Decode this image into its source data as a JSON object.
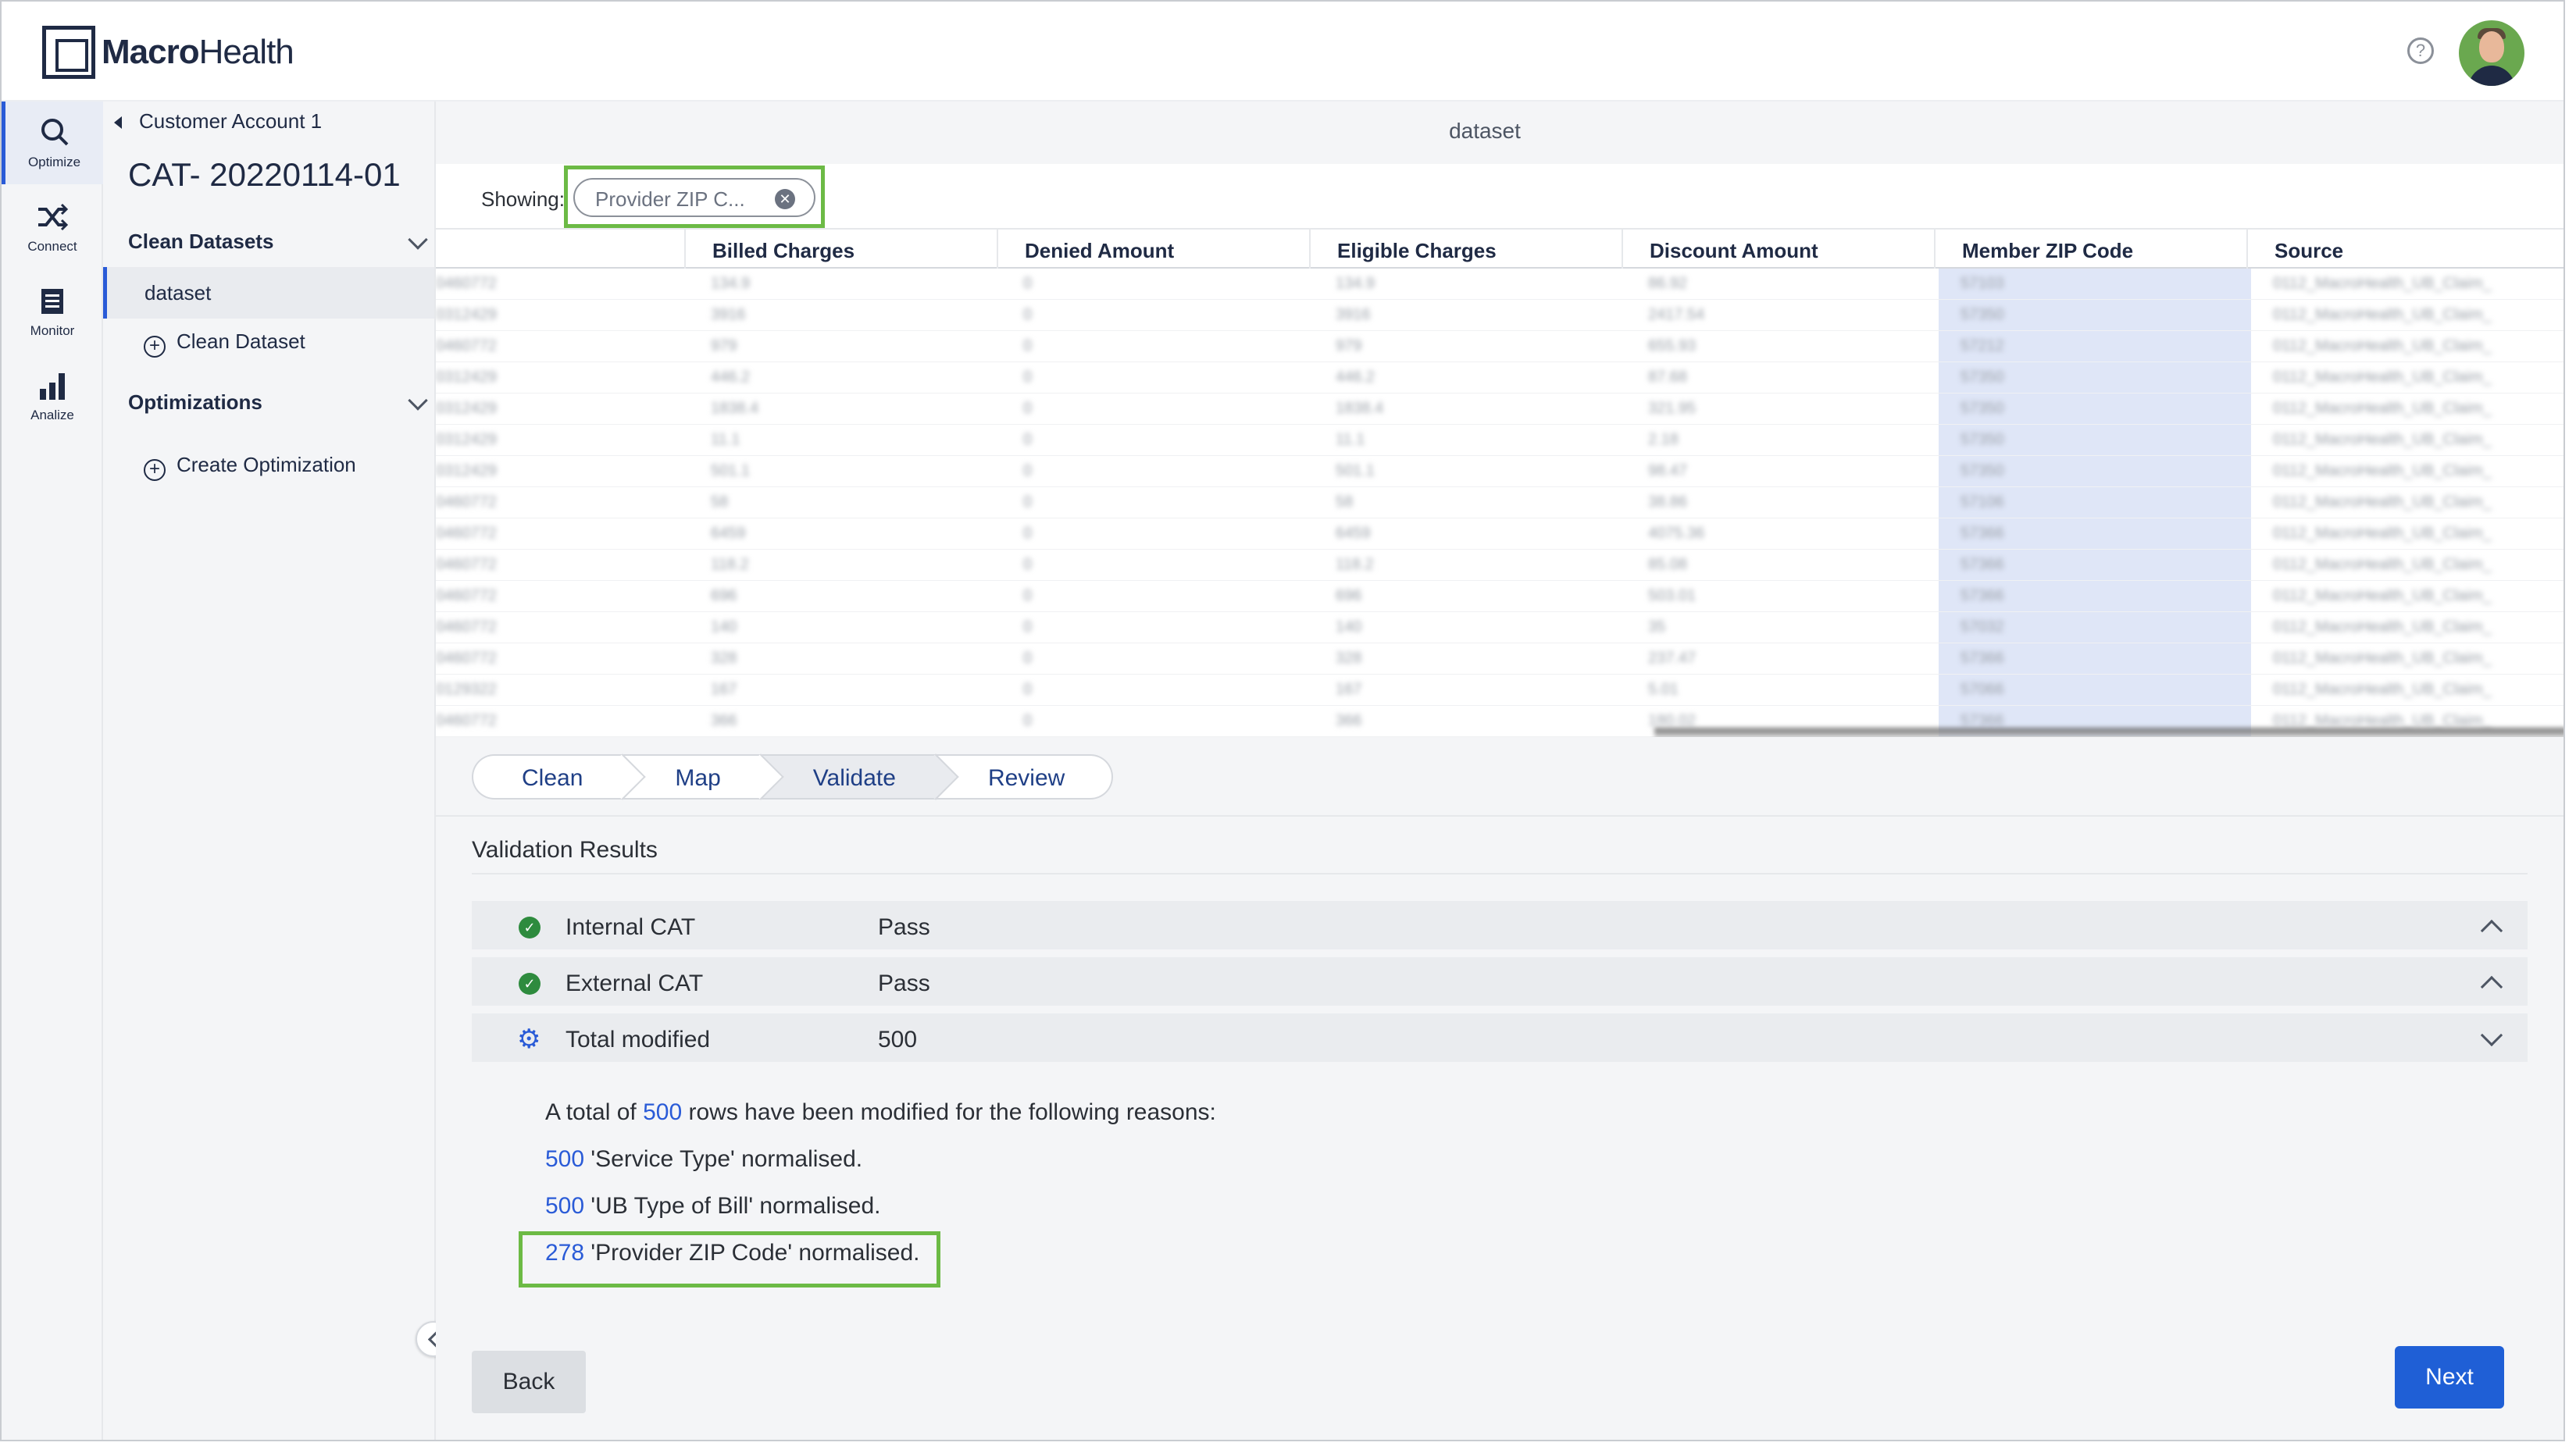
{
  "brand": {
    "name_bold": "Macro",
    "name_light": "Health"
  },
  "header": {
    "help_glyph": "?"
  },
  "rail": [
    {
      "label": "Optimize",
      "icon": "search-icon"
    },
    {
      "label": "Connect",
      "icon": "shuffle-icon"
    },
    {
      "label": "Monitor",
      "icon": "document-icon"
    },
    {
      "label": "Analize",
      "icon": "bar-chart-icon"
    }
  ],
  "sidebar": {
    "breadcrumb": "Customer Account 1",
    "project_title": "CAT- 20220114-01",
    "section_clean": "Clean Datasets",
    "dataset_item": "dataset",
    "add_clean": "Clean Dataset",
    "section_opt": "Optimizations",
    "add_opt": "Create Optimization"
  },
  "main": {
    "title": "dataset",
    "showing_label": "Showing:",
    "filter_chip": "Provider ZIP C..."
  },
  "table": {
    "columns": [
      "Billed Charges",
      "Denied Amount",
      "Eligible Charges",
      "Discount Amount",
      "Member ZIP Code",
      "Source"
    ],
    "rows": [
      [
        "0460772",
        "134.9",
        "0",
        "134.9",
        "86.92",
        "57103",
        "0112_MacroHealth_UB_Claim_"
      ],
      [
        "0312429",
        "3916",
        "0",
        "3916",
        "2417.54",
        "57350",
        "0112_MacroHealth_UB_Claim_"
      ],
      [
        "0460772",
        "979",
        "0",
        "979",
        "655.93",
        "57212",
        "0112_MacroHealth_UB_Claim_"
      ],
      [
        "0312429",
        "446.2",
        "0",
        "446.2",
        "87.68",
        "57350",
        "0112_MacroHealth_UB_Claim_"
      ],
      [
        "0312429",
        "1838.4",
        "0",
        "1838.4",
        "321.95",
        "57350",
        "0112_MacroHealth_UB_Claim_"
      ],
      [
        "0312429",
        "11.1",
        "0",
        "11.1",
        "2.18",
        "57350",
        "0112_MacroHealth_UB_Claim_"
      ],
      [
        "0312429",
        "501.1",
        "0",
        "501.1",
        "98.47",
        "57350",
        "0112_MacroHealth_UB_Claim_"
      ],
      [
        "0460772",
        "58",
        "0",
        "58",
        "38.86",
        "57106",
        "0112_MacroHealth_UB_Claim_"
      ],
      [
        "0460772",
        "6459",
        "0",
        "6459",
        "4075.36",
        "57366",
        "0112_MacroHealth_UB_Claim_"
      ],
      [
        "0460772",
        "118.2",
        "0",
        "118.2",
        "85.08",
        "57366",
        "0112_MacroHealth_UB_Claim_"
      ],
      [
        "0460772",
        "696",
        "0",
        "696",
        "503.01",
        "57366",
        "0112_MacroHealth_UB_Claim_"
      ],
      [
        "0460772",
        "140",
        "0",
        "140",
        "35",
        "57032",
        "0112_MacroHealth_UB_Claim_"
      ],
      [
        "0460772",
        "328",
        "0",
        "328",
        "237.47",
        "57366",
        "0112_MacroHealth_UB_Claim_"
      ],
      [
        "0129322",
        "167",
        "0",
        "167",
        "5.01",
        "57066",
        "0112_MacroHealth_UB_Claim_"
      ],
      [
        "0460772",
        "366",
        "0",
        "366",
        "180.02",
        "57366",
        "0112_MacroHealth_UB_Claim_"
      ]
    ]
  },
  "stepper": [
    "Clean",
    "Map",
    "Validate",
    "Review"
  ],
  "validation": {
    "title": "Validation Results",
    "rows": [
      {
        "name": "Internal CAT",
        "value": "Pass"
      },
      {
        "name": "External CAT",
        "value": "Pass"
      },
      {
        "name": "Total modified",
        "value": "500"
      }
    ],
    "summary": {
      "prefix": "A total of",
      "count": "500",
      "suffix": "rows have been modified for the following reasons:"
    },
    "reasons": [
      {
        "count": "500",
        "text": "'Service Type' normalised."
      },
      {
        "count": "500",
        "text": "'UB Type of Bill' normalised."
      },
      {
        "count": "278",
        "text": "'Provider ZIP Code' normalised."
      }
    ]
  },
  "buttons": {
    "back": "Back",
    "next": "Next"
  },
  "colors": {
    "accent": "#2a5bd7",
    "highlight": "#6cba45",
    "pass": "#2e8b3e",
    "primary_button": "#1f5fd6"
  }
}
